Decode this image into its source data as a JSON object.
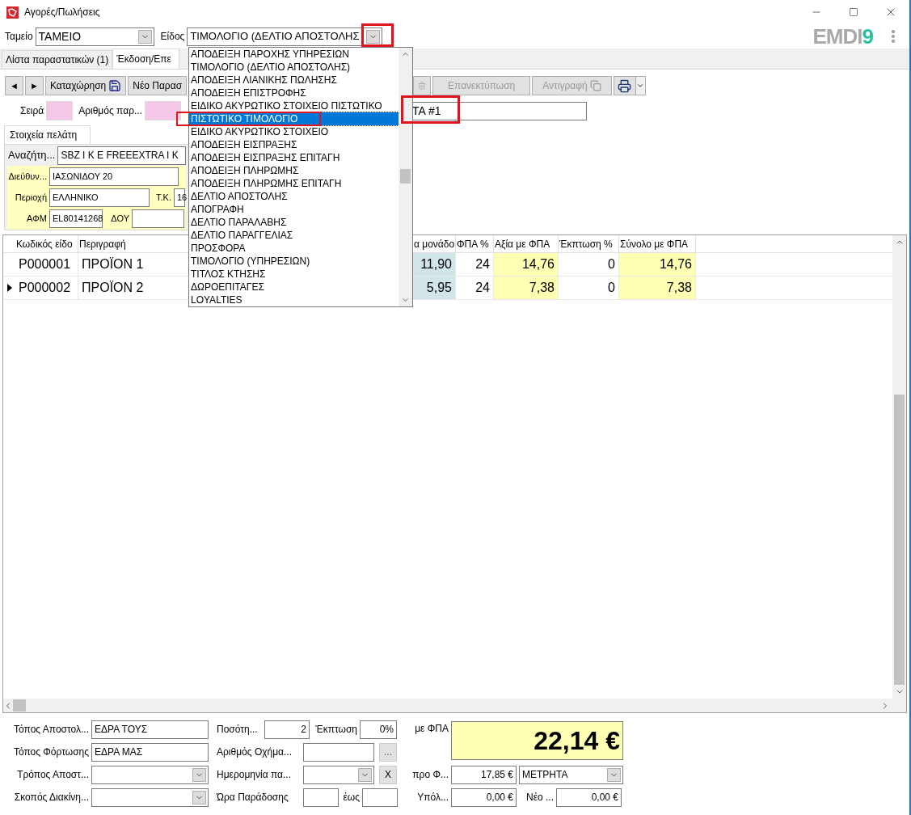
{
  "window": {
    "title": "Αγορές/Πωλήσεις"
  },
  "header": {
    "fields": [
      {
        "label": "Ταμείο",
        "value": "ΤΑΜΕΙΟ"
      },
      {
        "label": "Είδος",
        "value": "ΤΙΜΟΛΟΓΙΟ (ΔΕΛΤΙΟ ΑΠΟΣΤΟΛΗΣ"
      }
    ],
    "logo": "EMDI9"
  },
  "tabs": [
    {
      "label": "Λίστα παραστατικών (1)",
      "selected": false
    },
    {
      "label": "Έκδοση/Επε",
      "selected": true
    }
  ],
  "toolbar": {
    "left": [
      {
        "kind": "arrow",
        "label": "◄",
        "disabled": false
      },
      {
        "kind": "arrow",
        "label": "►",
        "disabled": false
      },
      {
        "kind": "save",
        "label": "Καταχώρηση",
        "disabled": false
      },
      {
        "kind": "plain",
        "label": "Νέο Παρασ",
        "disabled": false
      }
    ],
    "right": [
      {
        "kind": "trash",
        "disabled": true
      },
      {
        "kind": "plain",
        "label": "Επανεκτύπωση",
        "disabled": true
      },
      {
        "kind": "copy",
        "label": "Αντιγραφή",
        "disabled": true
      },
      {
        "kind": "print"
      }
    ]
  },
  "document": {
    "series_label": "Σειρά",
    "number_label": "Αριθμός παρ...",
    "reference": "ΤΑ #1"
  },
  "customer": {
    "tab": "Στοιχεία πελάτη",
    "search_label": "Αναζήτη...",
    "search": "SBZ I K E  FREEEXTRA I K",
    "address_label": "Διεύθυν...",
    "address": "ΙΑΣΩΝΙΔΟΥ 20",
    "area_label": "Περιοχή",
    "area": "ΕΛΛΗΝΙΚΟ",
    "zip_label": "Τ.Κ.",
    "zip": "16",
    "vat_label": "ΑΦΜ",
    "vat": "EL80141268",
    "tax_office_label": "ΔΟΥ"
  },
  "lines": {
    "columns": [
      {
        "label": "Κωδικός είδο",
        "kind": "text"
      },
      {
        "label": "Περιγραφή",
        "kind": "text"
      },
      {
        "label": "α μονάδο",
        "kind": "price"
      },
      {
        "label": "ΦΠΑ %",
        "kind": "number"
      },
      {
        "label": "Αξία με ΦΠΑ",
        "kind": "amount"
      },
      {
        "label": "Έκπτωση %",
        "kind": "number"
      },
      {
        "label": "Σύνολο με ΦΠΑ",
        "kind": "amount"
      }
    ],
    "rows": [
      {
        "current": false,
        "cells": [
          "P000001",
          "ΠΡΟΪΟΝ 1",
          "11,90",
          "24",
          "14,76",
          "0",
          "14,76"
        ]
      },
      {
        "current": true,
        "cells": [
          "P000002",
          "ΠΡΟΪΟΝ 2",
          "5,95",
          "24",
          "7,38",
          "0",
          "7,38"
        ]
      }
    ]
  },
  "shipping": [
    {
      "label": "Τόπος Αποστολ...",
      "kind": "text",
      "value": "ΕΔΡΑ ΤΟΥΣ"
    },
    {
      "label": "Τόπος Φόρτωσης",
      "kind": "text",
      "value": "ΕΔΡΑ ΜΑΣ"
    },
    {
      "label": "Τρόπος Αποστ...",
      "kind": "combo"
    },
    {
      "label": "Σκοπός Διακίνη...",
      "kind": "combo"
    }
  ],
  "delivery": {
    "quantity_label": "Ποσότη...",
    "quantity": "2",
    "discount_label": "Έκπτωση",
    "discount": "0%",
    "vehicle_label": "Αριθμός Οχήμα...",
    "vehicle_button": "...",
    "date_label": "Ημερομηνία πα...",
    "clear_button": "X",
    "time_label": "Ώρα Παράδοσης",
    "until_label": "έως"
  },
  "totals": {
    "total_label": "με ΦΠΑ",
    "total": "22,14 €",
    "net_label": "προ Φ...",
    "net": "17,85 €",
    "payment": "ΜΕΤΡΗΤΑ",
    "balance_label": "Υπόλ...",
    "balance": "0,00 €",
    "new_label": "Νέο ...",
    "new_balance": "0,00 €"
  },
  "dropdown": {
    "items": [
      {
        "label": "ΑΠΟΔΕΙΞΗ ΠΑΡΟΧΗΣ ΥΠΗΡΕΣΙΩΝ",
        "selected": false
      },
      {
        "label": "ΤΙΜΟΛΟΓΙΟ (ΔΕΛΤΙΟ ΑΠΟΣΤΟΛΗΣ)",
        "selected": false
      },
      {
        "label": "ΑΠΟΔΕΙΞΗ ΛΙΑΝΙΚΗΣ ΠΩΛΗΣΗΣ",
        "selected": false
      },
      {
        "label": "ΑΠΟΔΕΙΞΗ ΕΠΙΣΤΡΟΦΗΣ",
        "selected": false
      },
      {
        "label": "ΕΙΔΙΚΟ ΑΚΥΡΩΤΙΚΟ ΣΤΟΙΧΕΙΟ ΠΙΣΤΩΤΙΚΟ",
        "selected": false
      },
      {
        "label": "ΠΙΣΤΩΤΙΚΟ ΤΙΜΟΛΟΓΙΟ",
        "selected": true
      },
      {
        "label": "ΕΙΔΙΚΟ ΑΚΥΡΩΤΙΚΟ ΣΤΟΙΧΕΙΟ",
        "selected": false
      },
      {
        "label": "ΑΠΟΔΕΙΞΗ ΕΙΣΠΡΑΞΗΣ",
        "selected": false
      },
      {
        "label": "ΑΠΟΔΕΙΞΗ ΕΙΣΠΡΑΞΗΣ ΕΠΙΤΑΓΗ",
        "selected": false
      },
      {
        "label": "ΑΠΟΔΕΙΞΗ ΠΛΗΡΩΜΗΣ",
        "selected": false
      },
      {
        "label": "ΑΠΟΔΕΙΞΗ ΠΛΗΡΩΜΗΣ ΕΠΙΤΑΓΗ",
        "selected": false
      },
      {
        "label": "ΔΕΛΤΙΟ ΑΠΟΣΤΟΛΗΣ",
        "selected": false
      },
      {
        "label": "ΑΠΟΓΡΑΦΗ",
        "selected": false
      },
      {
        "label": "ΔΕΛΤΙΟ ΠΑΡΑΛΑΒΗΣ",
        "selected": false
      },
      {
        "label": "ΔΕΛΤΙΟ ΠΑΡΑΓΓΕΛΙΑΣ",
        "selected": false
      },
      {
        "label": "ΠΡΟΣΦΟΡΑ",
        "selected": false
      },
      {
        "label": "ΤΙΜΟΛΟΓΙΟ (ΥΠΗΡΕΣΙΩΝ)",
        "selected": false
      },
      {
        "label": "ΤΙΤΛΟΣ ΚΤΗΣΗΣ",
        "selected": false
      },
      {
        "label": "ΔΩΡΟΕΠΙΤΑΓΕΣ",
        "selected": false
      },
      {
        "label": "LOYALTIES",
        "selected": false
      }
    ]
  }
}
